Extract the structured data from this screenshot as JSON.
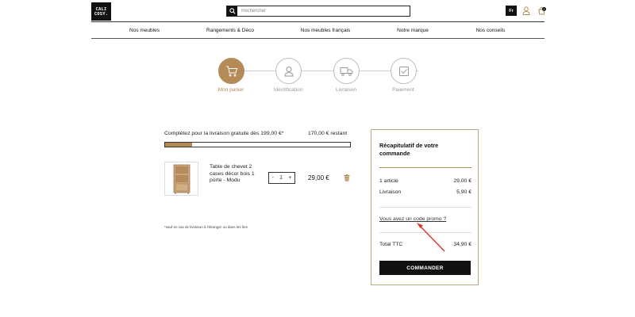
{
  "header": {
    "logo_line1": "CALI",
    "logo_line2": "COSY.",
    "search_placeholder": "Rechercher",
    "language": "Fr",
    "cart_count": "1"
  },
  "nav": {
    "items": [
      "Nos meubles",
      "Rangements & Déco",
      "Nos meubles français",
      "Notre marque",
      "Nos conseils"
    ]
  },
  "steps": [
    {
      "label": "Mon panier",
      "icon": "cart-icon",
      "active": true
    },
    {
      "label": "Identification",
      "icon": "user-icon",
      "active": false
    },
    {
      "label": "Livraison",
      "icon": "truck-icon",
      "active": false
    },
    {
      "label": "Paiement",
      "icon": "checkbox-icon",
      "active": false
    }
  ],
  "cart": {
    "free_shipping_text": "Complétez pour la livraison gratuite dès 199,00 €*",
    "remaining_text": "170,00 € restant",
    "progress_fraction": 0.146,
    "item": {
      "title": "Table de chevet 2 cases décor bois 1 porte - Modu",
      "quantity": "1",
      "qty_minus": "-",
      "qty_plus": "+",
      "price": "29,00 €"
    },
    "footnote": "*sauf en cas de livraison à l'étranger ou dans les îles"
  },
  "summary": {
    "title": "Récapitulatif de votre commande",
    "article_label": "1 article",
    "article_value": "29,00 €",
    "delivery_label": "Livraison",
    "delivery_value": "5,90 €",
    "promo_link": "Vous avez un code promo ?",
    "total_label": "Total TTC",
    "total_value": "34,90 €",
    "order_button": "COMMANDER"
  },
  "colors": {
    "accent": "#b48a57",
    "dark": "#111111",
    "arrow": "#d9352b"
  }
}
